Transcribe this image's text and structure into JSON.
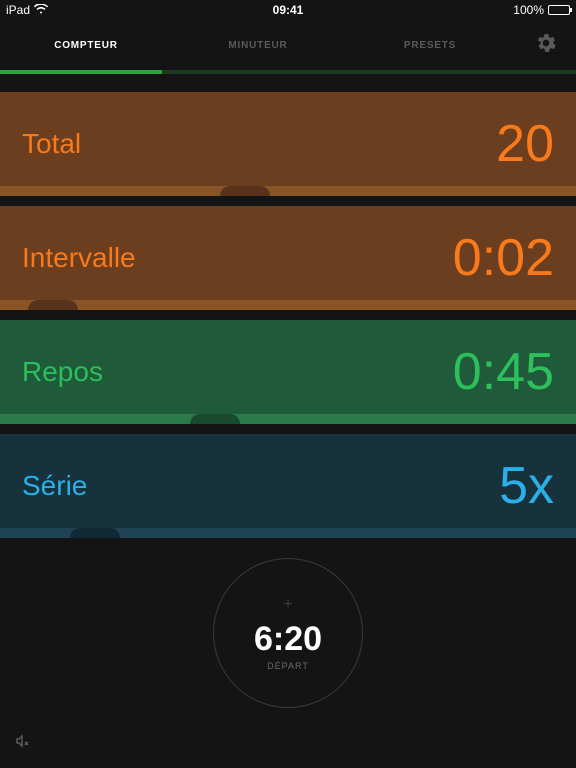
{
  "status_bar": {
    "device": "iPad",
    "time": "09:41",
    "battery_text": "100%"
  },
  "tabs": [
    {
      "label": "COMPTEUR",
      "active": true
    },
    {
      "label": "MINUTEUR",
      "active": false
    },
    {
      "label": "PRESETS",
      "active": false
    }
  ],
  "rows": {
    "total": {
      "label": "Total",
      "value": "20"
    },
    "intervalle": {
      "label": "Intervalle",
      "value": "0:02"
    },
    "repos": {
      "label": "Repos",
      "value": "0:45"
    },
    "serie": {
      "label": "Série",
      "value": "5x"
    }
  },
  "start": {
    "plus": "+",
    "time": "6:20",
    "label": "DÉPART"
  }
}
